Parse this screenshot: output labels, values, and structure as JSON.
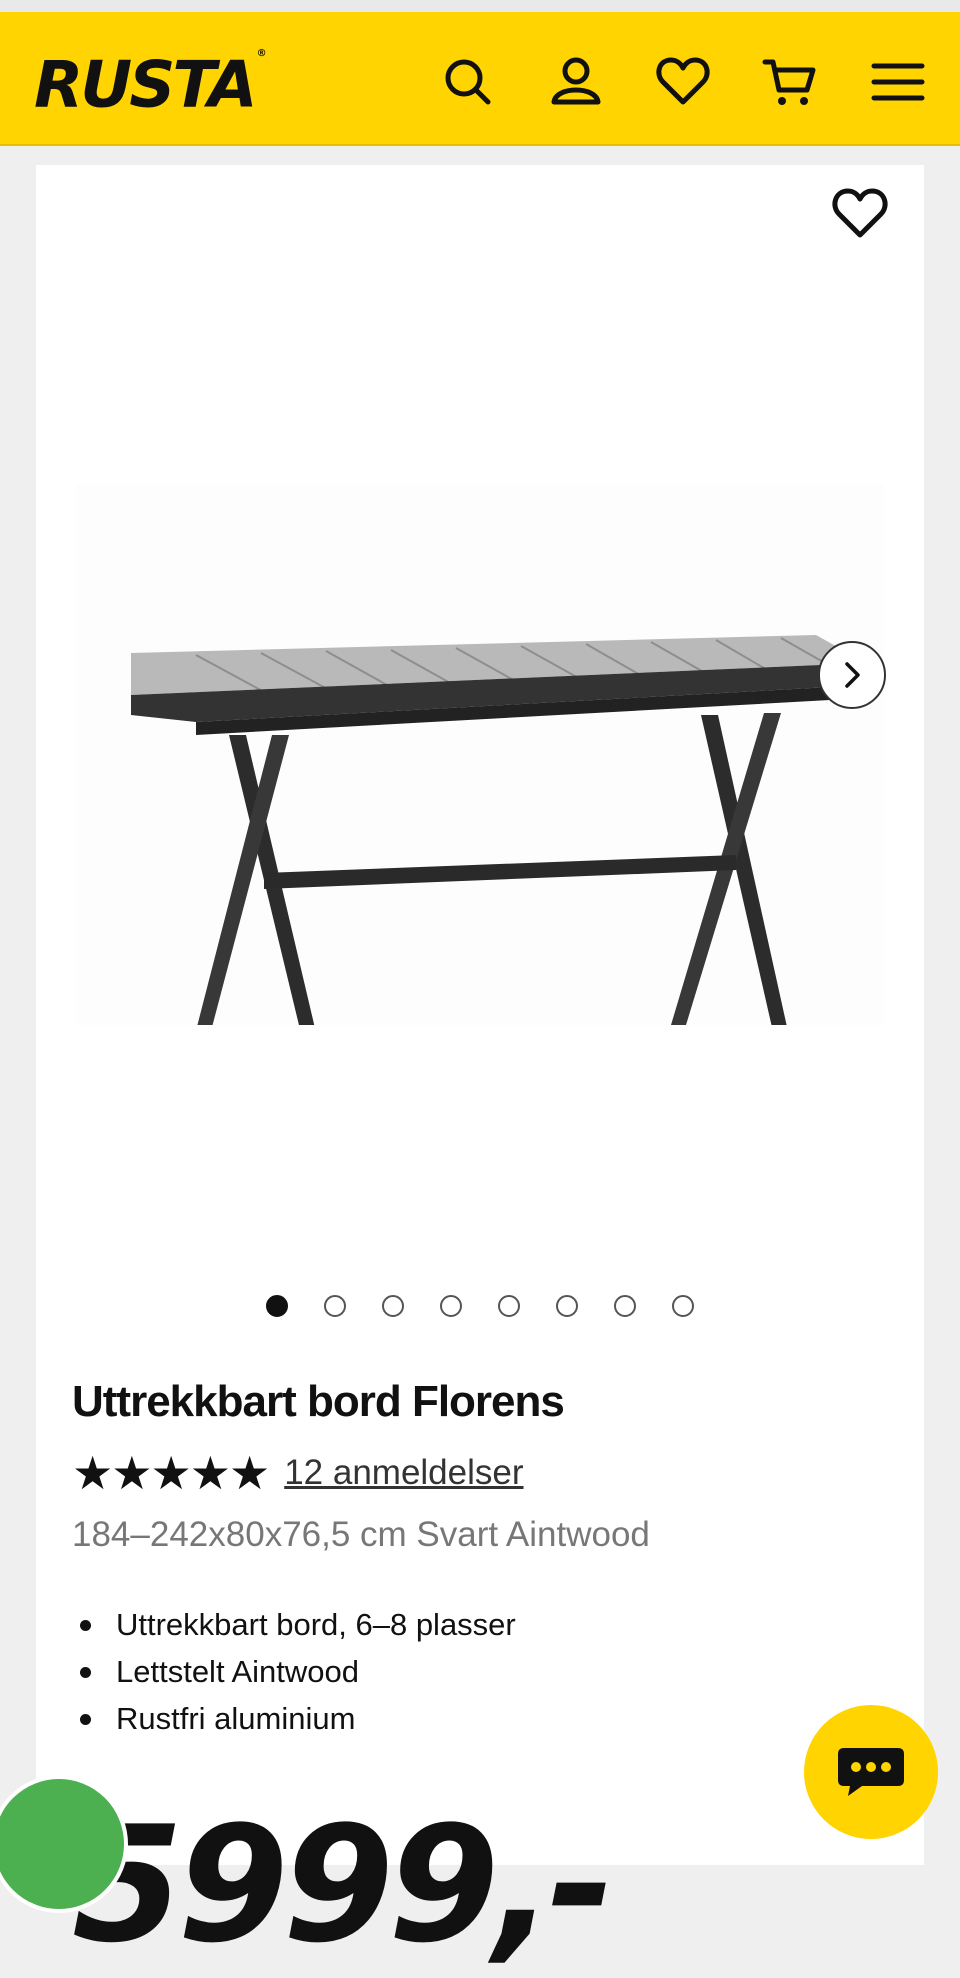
{
  "header": {
    "logo": "RUSTA",
    "logo_mark": "®",
    "icons": [
      "search-icon",
      "account-icon",
      "wishlist-icon",
      "cart-icon",
      "menu-icon"
    ],
    "background_color": "#ffd400"
  },
  "product": {
    "image_icon": "table-image",
    "favorite_icon": "heart-icon",
    "next_icon": "chevron-right-icon",
    "carousel": {
      "total": 8,
      "active": 1
    },
    "title": "Uttrekkbart bord Florens",
    "rating": {
      "stars": "★★★★★",
      "value": 5,
      "max": 5,
      "reviews_label": "12 anmeldelser"
    },
    "subtitle": "184–242x80x76,5 cm Svart Aintwood",
    "features": [
      "Uttrekkbart bord, 6–8 plasser",
      "Lettstelt Aintwood",
      "Rustfri aluminium"
    ],
    "price": "5999,-"
  },
  "chat": {
    "icon": "chat-icon",
    "color": "#ffd400"
  },
  "badge": {
    "icon": "green-badge-icon",
    "color": "#4caf50"
  }
}
